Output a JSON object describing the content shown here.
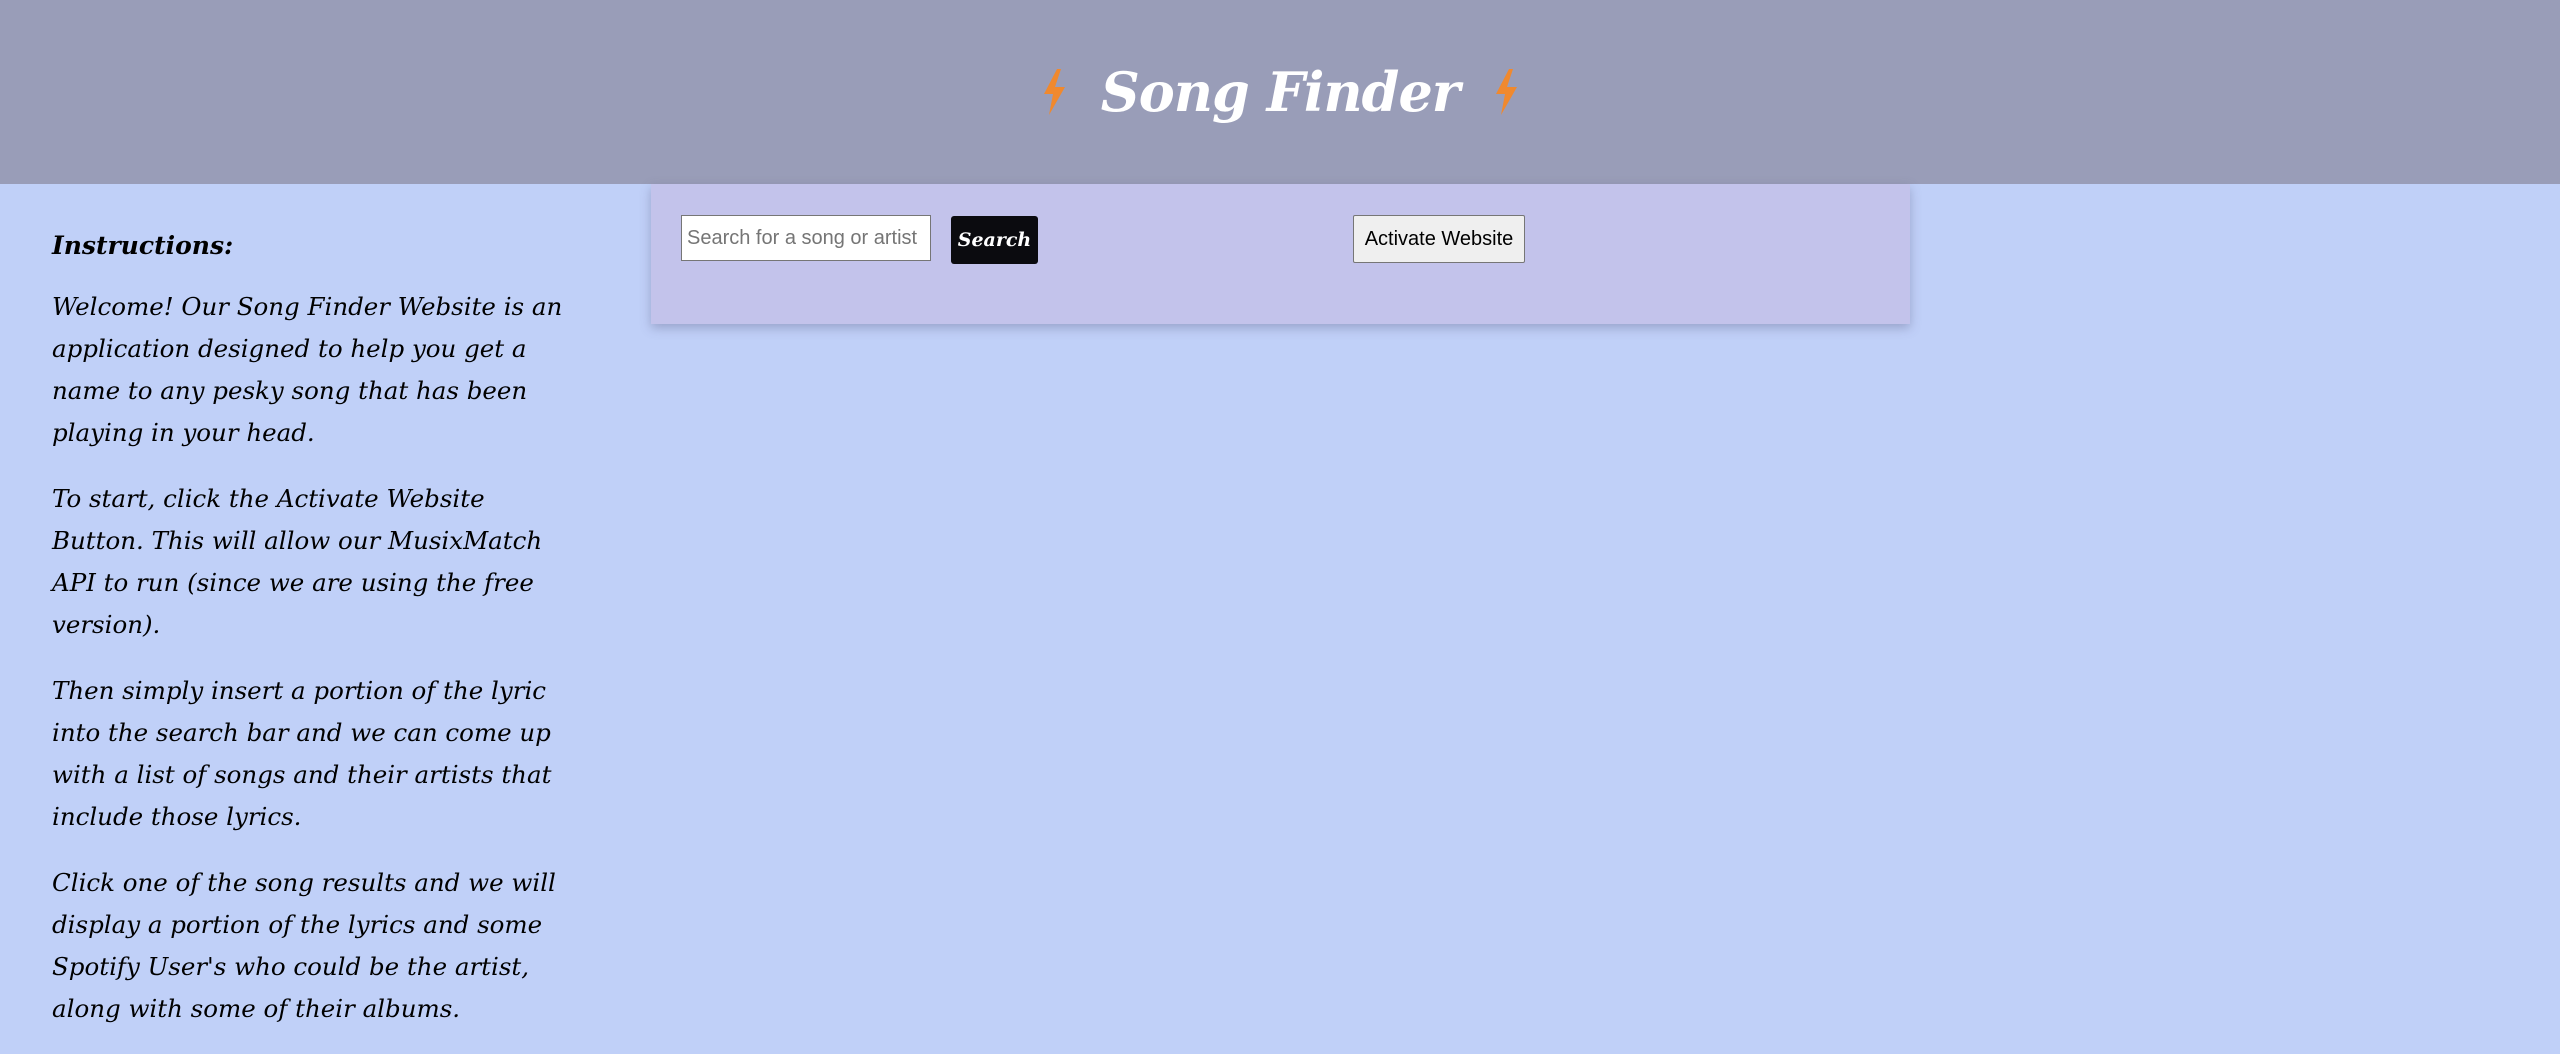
{
  "header": {
    "title": "Song Finder",
    "icon_left": "bolt-icon",
    "icon_right": "bolt-icon",
    "background": "#999db8",
    "icon_color": "#f0892e"
  },
  "instructions": {
    "heading": "Instructions:",
    "paragraphs": [
      "Welcome! Our Song Finder Website is an application designed to help you get a name to any pesky song that has been playing in your head.",
      "To start, click the Activate Website Button. This will allow our MusixMatch API to run (since we are using the free version).",
      "Then simply insert a portion of the lyric into the search bar and we can come up with a list of songs and their artists that include those lyrics.",
      "Click one of the song results and we will display a portion of the lyrics and some Spotify User's who could be the artist, along with some of their albums."
    ]
  },
  "search": {
    "placeholder": "Search for a song or artist",
    "value": "",
    "button_label": "Search"
  },
  "activate": {
    "button_label": "Activate Website"
  },
  "colors": {
    "page_background": "#c0d0f8",
    "panel_background": "#c3c3eb",
    "search_button": "#0b0b0f"
  }
}
